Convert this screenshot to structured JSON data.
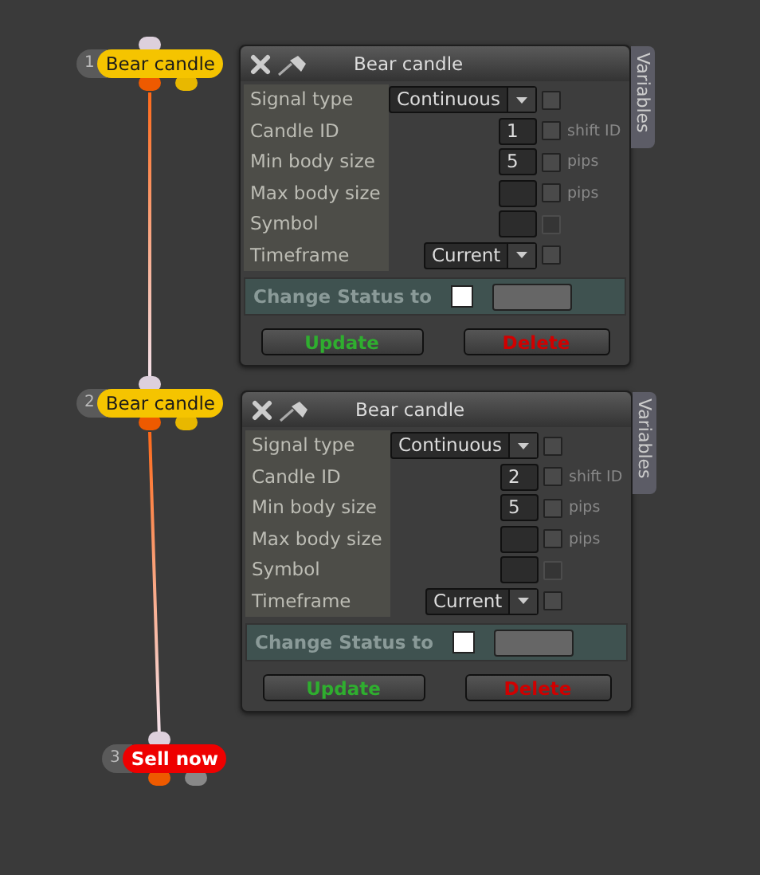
{
  "nodes": [
    {
      "number": "1",
      "label": "Bear candle",
      "kind": "condition"
    },
    {
      "number": "2",
      "label": "Bear candle",
      "kind": "condition"
    },
    {
      "number": "3",
      "label": "Sell now",
      "kind": "action"
    }
  ],
  "panels": [
    {
      "title": "Bear candle",
      "side_tab": "Variables",
      "rows": [
        {
          "label": "Signal type",
          "kind": "dropdown",
          "value": "Continuous",
          "checked": false,
          "disabled": false
        },
        {
          "label": "Candle ID",
          "kind": "number",
          "value": "1",
          "unit": "shift ID",
          "checked": false,
          "disabled": false
        },
        {
          "label": "Min body size",
          "kind": "number",
          "value": "5",
          "unit": "pips",
          "checked": false,
          "disabled": false
        },
        {
          "label": "Max body size",
          "kind": "number",
          "unit": "pips",
          "checked": false,
          "disabled": false
        },
        {
          "label": "Symbol",
          "kind": "number",
          "checked": false,
          "disabled": true
        },
        {
          "label": "Timeframe",
          "kind": "dropdown",
          "value": "Current",
          "checked": false,
          "disabled": false
        }
      ],
      "status_label": "Change Status to",
      "status_checked": false,
      "buttons": [
        {
          "label": "Update",
          "kind": "update"
        },
        {
          "label": "Delete",
          "kind": "delete"
        }
      ]
    },
    {
      "title": "Bear candle",
      "side_tab": "Variables",
      "rows": [
        {
          "label": "Signal type",
          "kind": "dropdown",
          "value": "Continuous",
          "checked": false,
          "disabled": false
        },
        {
          "label": "Candle ID",
          "kind": "number",
          "value": "2",
          "unit": "shift ID",
          "checked": false,
          "disabled": false
        },
        {
          "label": "Min body size",
          "kind": "number",
          "value": "5",
          "unit": "pips",
          "checked": false,
          "disabled": false
        },
        {
          "label": "Max body size",
          "kind": "number",
          "unit": "pips",
          "checked": false,
          "disabled": false
        },
        {
          "label": "Symbol",
          "kind": "number",
          "checked": false,
          "disabled": true
        },
        {
          "label": "Timeframe",
          "kind": "dropdown",
          "value": "Current",
          "checked": false,
          "disabled": false
        }
      ],
      "status_label": "Change Status to",
      "status_checked": false,
      "buttons": [
        {
          "label": "Update",
          "kind": "update"
        },
        {
          "label": "Delete",
          "kind": "delete"
        }
      ]
    }
  ]
}
